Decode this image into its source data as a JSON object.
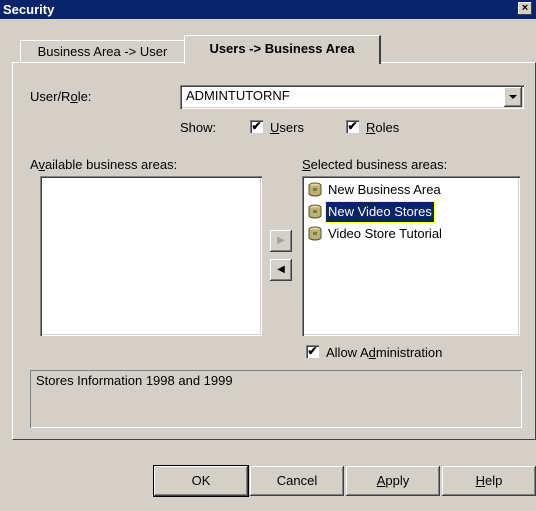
{
  "window": {
    "title": "Security",
    "close_label": "×"
  },
  "tabs": [
    {
      "label": "Business Area -> User",
      "active": false
    },
    {
      "label": "Users -> Business Area",
      "active": true
    }
  ],
  "user_role": {
    "label_pre": "User/R",
    "label_u": "o",
    "label_post": "le:",
    "value": "ADMINTUTORNF"
  },
  "show": {
    "label": "Show:",
    "users": {
      "checked": true,
      "label_u": "U",
      "label_post": "sers"
    },
    "roles": {
      "checked": true,
      "label_u": "R",
      "label_post": "oles"
    }
  },
  "available": {
    "label_pre": "A",
    "label_u": "v",
    "label_post": "ailable business areas:",
    "items": []
  },
  "selected": {
    "label_u": "S",
    "label_post": "elected business areas:",
    "items": [
      {
        "label": "New Business Area",
        "selected": false
      },
      {
        "label": "New Video Stores",
        "selected": true
      },
      {
        "label": "Video Store Tutorial",
        "selected": false
      }
    ]
  },
  "move_buttons": {
    "add": "▶",
    "remove": "◀"
  },
  "allow_admin": {
    "checked": true,
    "label_pre": "Allow A",
    "label_u": "d",
    "label_post": "ministration"
  },
  "description": "Stores Information 1998 and 1999",
  "buttons": {
    "ok": "OK",
    "cancel": "Cancel",
    "apply_u": "A",
    "apply_post": "pply",
    "help_u": "H",
    "help_post": "elp"
  },
  "check_mark": "✔",
  "colors": {
    "titlebar": "#0a246a",
    "face": "#d4d0c8",
    "selection": "#0a246a"
  }
}
